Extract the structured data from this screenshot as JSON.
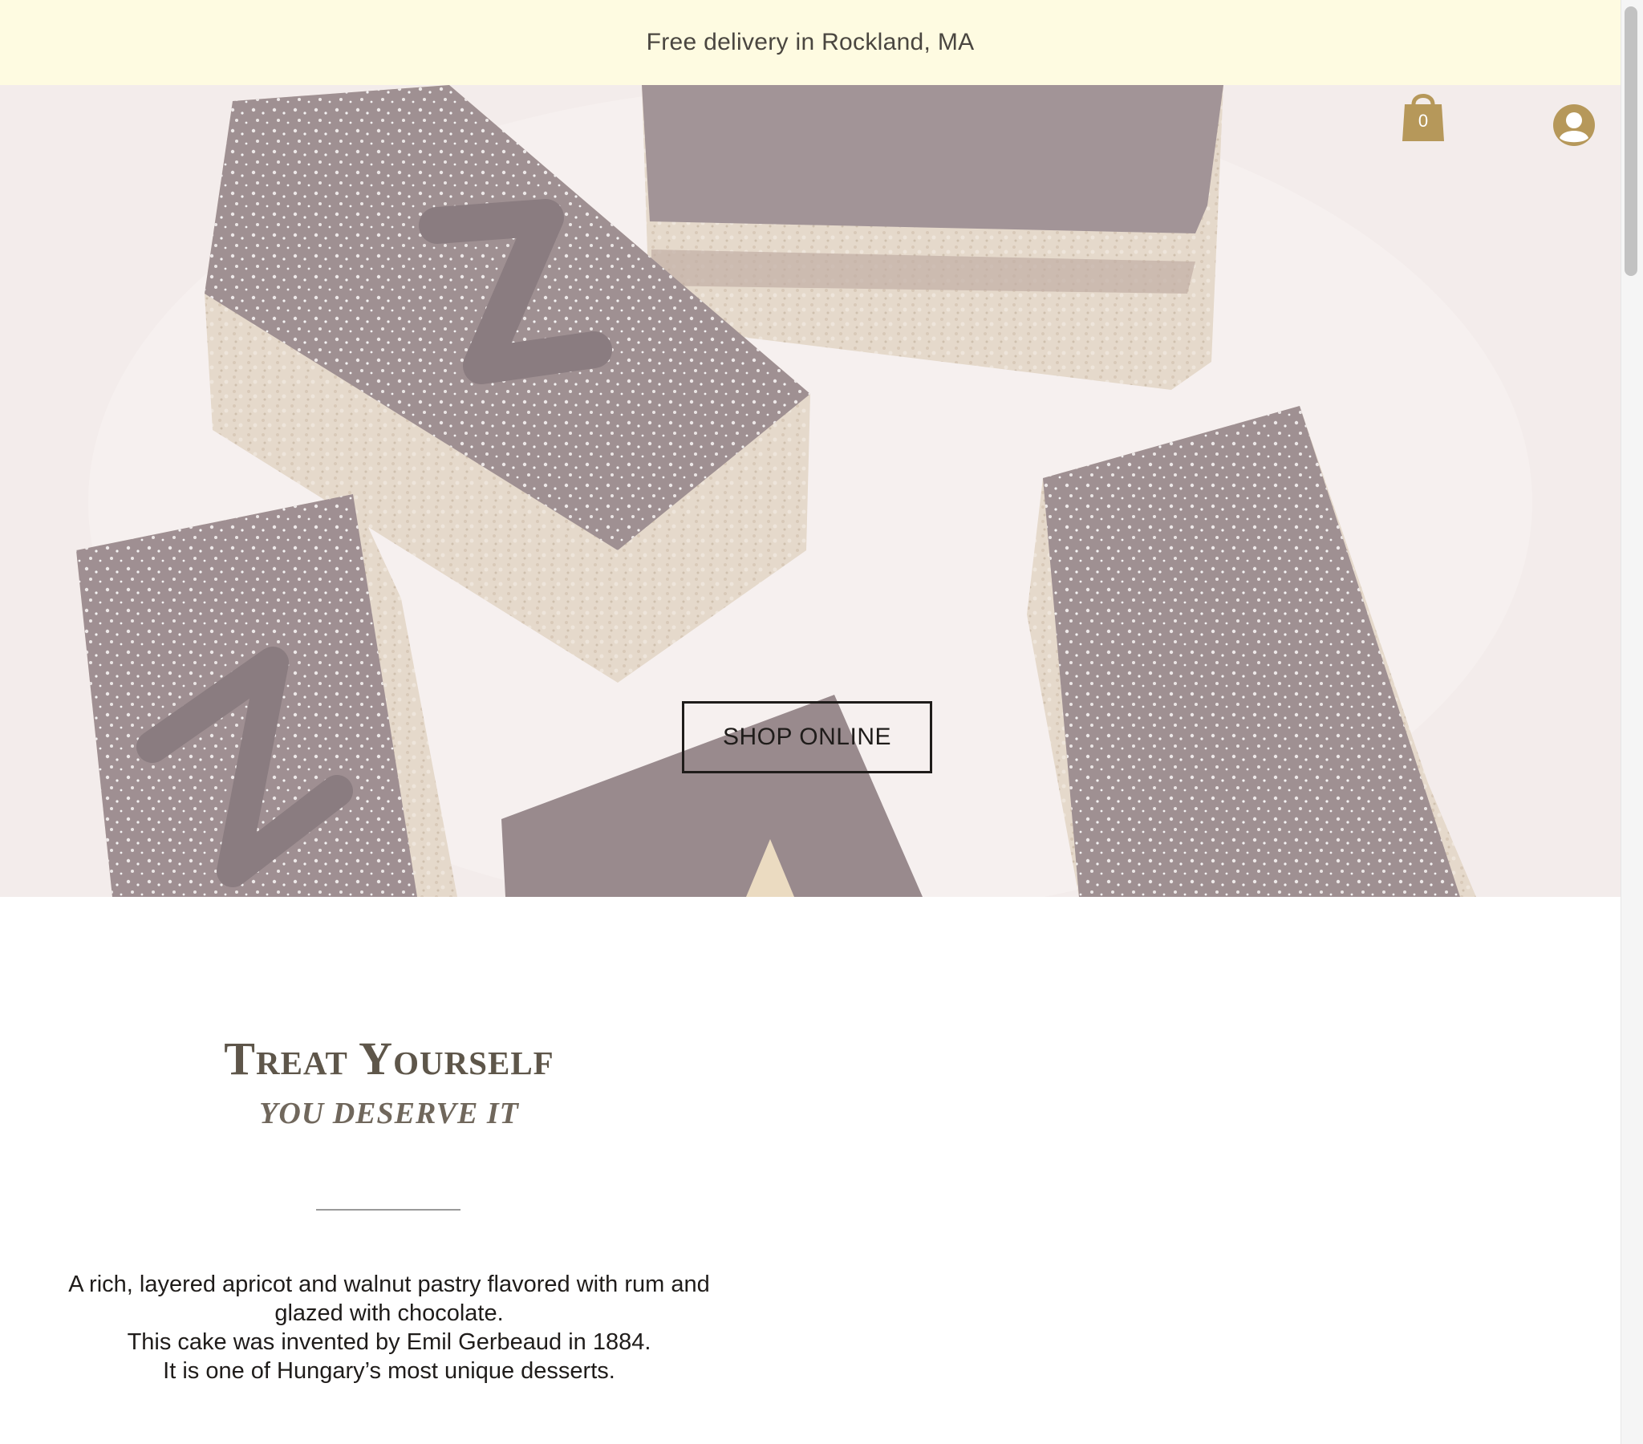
{
  "announcement": {
    "text": "Free delivery in Rockland, MA"
  },
  "header": {
    "cart": {
      "count": "0",
      "icon": "shopping-bag-icon"
    },
    "user": {
      "icon": "user-avatar-icon"
    }
  },
  "hero": {
    "cta_label": "SHOP ONLINE",
    "image": "chocolate-layered-pastry-photo"
  },
  "intro": {
    "heading": "Treat Yourself",
    "subheading": "YOU DESERVE IT",
    "description": [
      "A rich, layered apricot and walnut pastry flavored with rum and",
      "glazed with chocolate.",
      "This cake was invented by Emil Gerbeaud in 1884.",
      "It is one of Hungary’s most unique desserts."
    ]
  },
  "colors": {
    "announcement_bg": "#fefbe1",
    "accent_gold": "#b6985a",
    "heading": "#5e564a"
  }
}
